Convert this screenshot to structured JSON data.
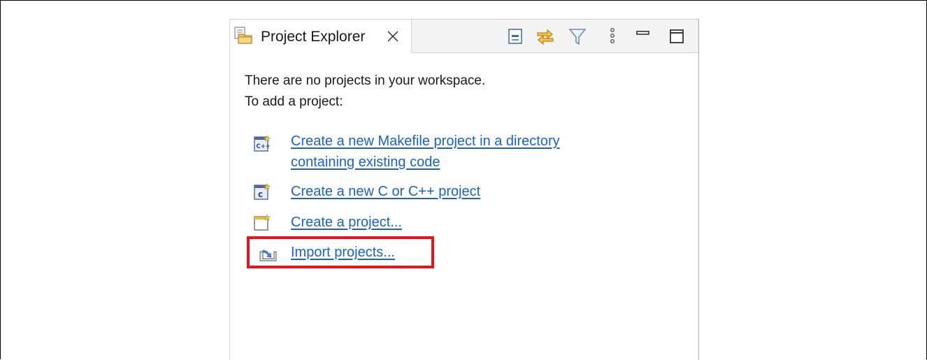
{
  "panel": {
    "tab_label": "Project Explorer",
    "tab_icon": "project-explorer-icon",
    "toolbar": [
      {
        "name": "collapse-all-icon"
      },
      {
        "name": "link-with-editor-icon"
      },
      {
        "name": "filter-icon"
      },
      {
        "name": "view-menu-icon"
      },
      {
        "name": "minimize-icon"
      },
      {
        "name": "maximize-icon"
      }
    ]
  },
  "content": {
    "message_line1": "There are no projects in your workspace.",
    "message_line2": "To add a project:",
    "links": [
      {
        "line1": "Create a new Makefile project in a directory ",
        "line2": "containing existing code",
        "icon": "makefile-project-icon"
      },
      {
        "line1": "Create a new C or C++ project",
        "icon": "c-project-icon"
      },
      {
        "line1": "Create a project...",
        "icon": "new-project-icon"
      },
      {
        "line1": "Import projects...",
        "icon": "import-icon"
      }
    ]
  },
  "colors": {
    "link": "#1a62c8",
    "highlight": "#e8141b",
    "header_bg": "#f3f3f3"
  }
}
